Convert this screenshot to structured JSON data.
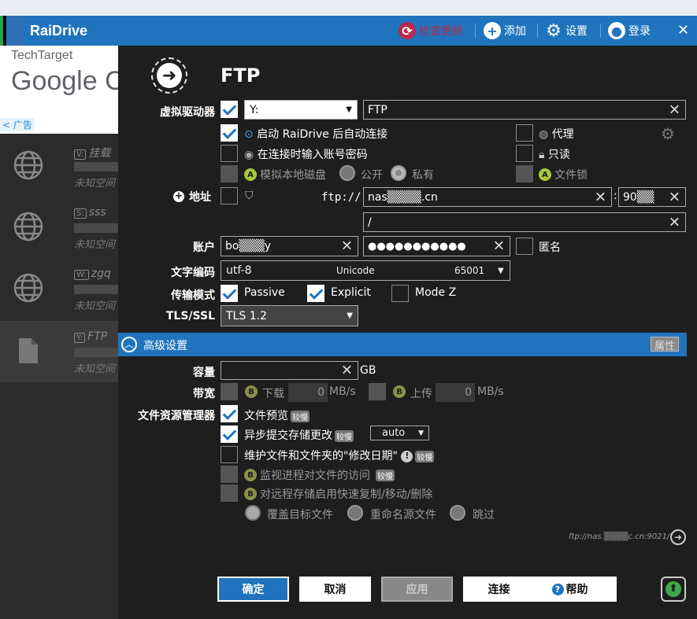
{
  "app": {
    "title": "RaiDrive"
  },
  "toolbar": {
    "check_update": "检查更新",
    "add": "添加",
    "settings": "设置",
    "login": "登录",
    "close": "✕"
  },
  "ad": {
    "brand": "TechTarget",
    "logo": "Google C",
    "ad_label": "广告"
  },
  "sidebar": {
    "items": [
      {
        "letter": "V:",
        "name": "挂载",
        "status": "未知空间"
      },
      {
        "letter": "S:",
        "name": "sss",
        "status": "未知空间"
      },
      {
        "letter": "W:",
        "name": "zgq",
        "status": "未知空间"
      },
      {
        "letter": "Y:",
        "name": "FTP",
        "status": "未知空间",
        "selected": true
      }
    ]
  },
  "header": {
    "title": "FTP"
  },
  "form": {
    "virtual_drive": {
      "label": "虚拟驱动器",
      "drive_letter": "Y:",
      "name": "FTP"
    },
    "options": {
      "auto_connect": "启动 RaiDrive 后自动连接",
      "prompt_credentials": "在连接时输入账号密码",
      "simulate_local": "模拟本地磁盘",
      "public": "公开",
      "private": "私有",
      "proxy": "代理",
      "readonly": "只读",
      "file_lock": "文件锁"
    },
    "address": {
      "label": "地址",
      "scheme": "ftp://",
      "host": "nas▒▒▒▒.cn",
      "port": "90▒▒",
      "path": "/"
    },
    "account": {
      "label": "账户",
      "username": "bo▒▒▒y",
      "password": "●●●●●●●●●●●",
      "anonymous": "匿名"
    },
    "encoding": {
      "label": "文字编码",
      "value": "utf-8",
      "name": "Unicode",
      "codepage": "65001"
    },
    "transfer": {
      "label": "传输模式",
      "passive": "Passive",
      "explicit": "Explicit",
      "modez": "Mode Z"
    },
    "tls": {
      "label": "TLS/SSL",
      "value": "TLS 1.2"
    }
  },
  "advanced": {
    "title": "高级设置",
    "props_button": "属性",
    "capacity": {
      "label": "容量",
      "unit": "GB"
    },
    "bandwidth": {
      "label": "带宽",
      "download": "下载",
      "download_value": "0",
      "upload": "上传",
      "upload_value": "0",
      "unit": "MB/s"
    },
    "explorer": {
      "label": "文件资源管理器",
      "preview": "文件预览",
      "async": "异步提交存储更改",
      "async_mode": "auto",
      "maintain_dates": "维护文件和文件夹的\"修改日期\"",
      "monitor": "监视进程对文件的访问",
      "fast_copy": "对远程存储启用快速复制/移动/删除",
      "overwrite": "覆盖目标文件",
      "rename": "重命名源文件",
      "skip": "跳过",
      "badge": "较慢"
    }
  },
  "url_preview": "ftp://nas.▒▒▒▒c.cn:9021/",
  "buttons": {
    "ok": "确定",
    "cancel": "取消",
    "apply": "应用",
    "connect": "连接",
    "help": "帮助"
  },
  "colors": {
    "accent": "#1f74bd"
  }
}
